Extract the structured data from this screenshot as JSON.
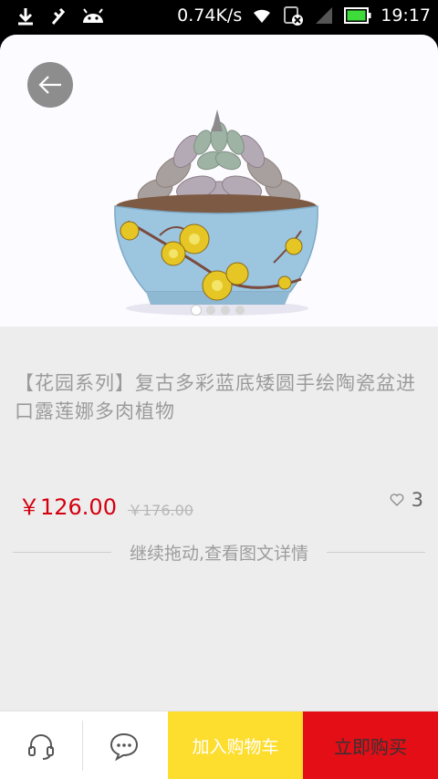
{
  "status_bar": {
    "speed": "0.74K/s",
    "time": "19:17"
  },
  "product": {
    "title": "【花园系列】复古多彩蓝底矮圆手绘陶瓷盆进口露莲娜多肉植物",
    "price": "￥126.00",
    "original_price": "￥176.00",
    "likes": "3",
    "image_count": 4,
    "active_image": 1
  },
  "drag_hint": "继续拖动,查看图文详情",
  "bottom_bar": {
    "add_to_cart": "加入购物车",
    "buy_now": "立即购买"
  },
  "colors": {
    "price_red": "#d4000f",
    "cart_yellow": "#fddd2e",
    "buy_red": "#e30e16"
  }
}
